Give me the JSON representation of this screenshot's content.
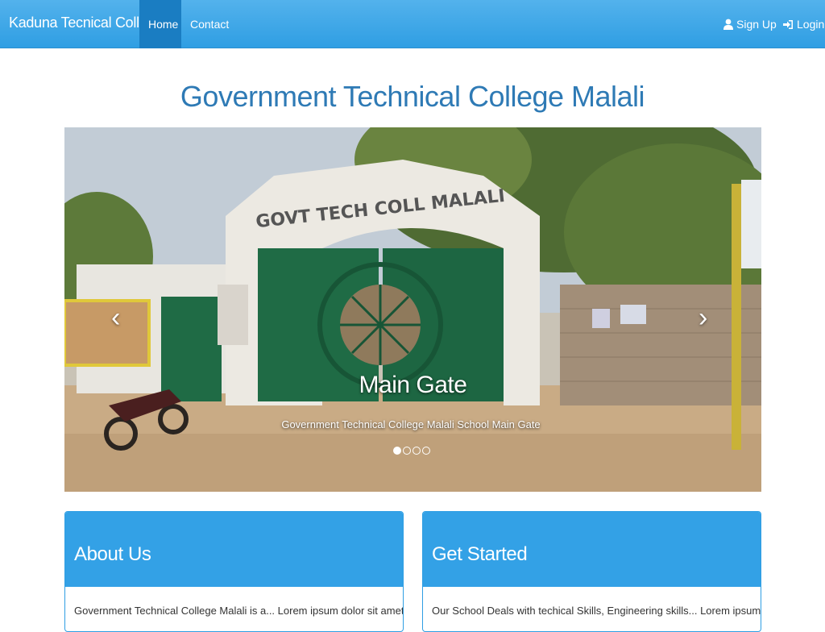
{
  "navbar": {
    "brand": "Kaduna Tecnical College",
    "items": [
      {
        "label": "Home",
        "active": true
      },
      {
        "label": "Contact",
        "active": false
      }
    ],
    "signup": {
      "label": "Sign Up",
      "icon": "user-icon"
    },
    "login": {
      "label": "Login",
      "icon": "login-icon"
    }
  },
  "page_title": "Government Technical College Malali",
  "carousel": {
    "slide": {
      "title": "Main Gate",
      "caption": "Government Technical College Malali School Main Gate",
      "sign_text": "GOVT TECH COLL MALALI"
    },
    "indicators": [
      true,
      false,
      false,
      false
    ],
    "prev_icon": "chevron-left-icon",
    "next_icon": "chevron-right-icon"
  },
  "panels": [
    {
      "heading": "About Us",
      "body": "Government Technical College Malali is a... Lorem ipsum dolor sit amet,"
    },
    {
      "heading": "Get Started",
      "body": "Our School Deals with techical Skills, Engineering skills... Lorem ipsum dolor sit"
    }
  ],
  "colors": {
    "navbar": "#2f9ee3",
    "navbar_active": "#1a7dc2",
    "title": "#2e7ab5",
    "panel_heading": "#33a1e6",
    "gate_green": "#1f6b45"
  }
}
